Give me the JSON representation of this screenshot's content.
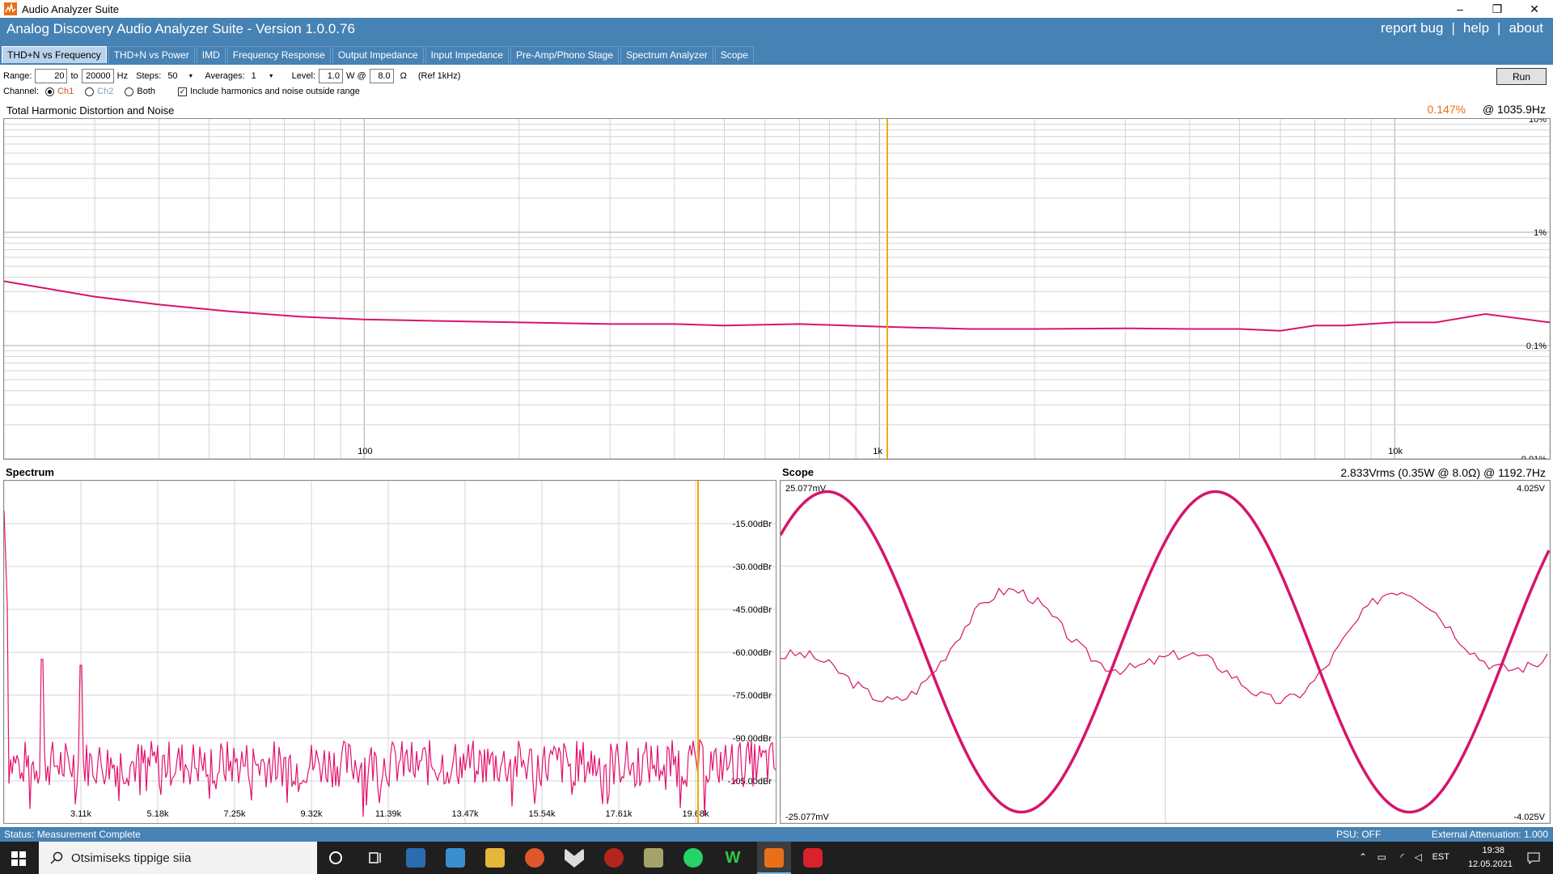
{
  "window": {
    "title": "Audio Analyzer Suite",
    "controls": {
      "minimize": "–",
      "restore": "❐",
      "close": "✕"
    }
  },
  "header": {
    "title": "Analog Discovery Audio Analyzer Suite - Version   1.0.0.76",
    "links": [
      "report bug",
      "help",
      "about"
    ],
    "separator": "|"
  },
  "tabs": [
    {
      "label": "THD+N vs Frequency",
      "active": true
    },
    {
      "label": "THD+N vs Power",
      "active": false
    },
    {
      "label": "IMD",
      "active": false
    },
    {
      "label": "Frequency Response",
      "active": false
    },
    {
      "label": "Output Impedance",
      "active": false
    },
    {
      "label": "Input Impedance",
      "active": false
    },
    {
      "label": "Pre-Amp/Phono Stage",
      "active": false
    },
    {
      "label": "Spectrum Analyzer",
      "active": false
    },
    {
      "label": "Scope",
      "active": false
    }
  ],
  "controls": {
    "range_label": "Range:",
    "range_from": "20",
    "to_label": "to",
    "range_to": "20000",
    "hz_label": "Hz",
    "steps_label": "Steps:",
    "steps_value": "50",
    "averages_label": "Averages:",
    "averages_value": "1",
    "level_label": "Level:",
    "level_value": "1.0",
    "w_at_label": "W @",
    "ohms_value": "8.0",
    "ohm_symbol": "Ω",
    "ref_label": "(Ref 1kHz)",
    "channel_label": "Channel:",
    "channel_options": [
      "Ch1",
      "Ch2",
      "Both"
    ],
    "channel_selected": "Ch1",
    "include_label": "Include harmonics and noise outside range",
    "include_checked": true,
    "run_label": "Run"
  },
  "thd_panel": {
    "title": "Total Harmonic Distortion and Noise",
    "readout_value": "0.147%",
    "readout_freq": "@ 1035.9Hz",
    "x_ticks": [
      "100",
      "1k",
      "10k"
    ],
    "y_ticks": [
      "10%",
      "1%",
      "0.1%",
      "0.01%"
    ],
    "cursor_freq_hz": 1035.9,
    "line_color": "#d6156c",
    "cursor_color": "#f2a900"
  },
  "spectrum_panel": {
    "title": "Spectrum",
    "y_ticks": [
      "-15.00dBr",
      "-30.00dBr",
      "-45.00dBr",
      "-60.00dBr",
      "-75.00dBr",
      "-90.00dBr",
      "-105.00dBr"
    ],
    "x_ticks": [
      "3.11k",
      "5.18k",
      "7.25k",
      "9.32k",
      "11.39k",
      "13.47k",
      "15.54k",
      "17.61k",
      "19.68k"
    ]
  },
  "scope_panel": {
    "title": "Scope",
    "readout": "2.833Vrms (0.35W @ 8.0Ω) @ 1192.7Hz",
    "left_top": "25.077mV",
    "left_bottom": "-25.077mV",
    "right_top": "4.025V",
    "right_bottom": "-4.025V"
  },
  "status": {
    "text": "Status: Measurement Complete",
    "psu": "PSU: OFF",
    "attenuation": "External Attenuation: 1.000"
  },
  "taskbar": {
    "search_placeholder": "Otsimiseks tippige siia",
    "lang": "EST",
    "time": "19:38",
    "date": "12.05.2021"
  },
  "chart_data": [
    {
      "type": "line",
      "title": "Total Harmonic Distortion and Noise",
      "x_scale": "log",
      "y_scale": "log",
      "xlim": [
        20,
        20000
      ],
      "ylim": [
        0.01,
        10
      ],
      "x_ticks": [
        "100",
        "1k",
        "10k"
      ],
      "y_ticks": [
        "10%",
        "1%",
        "0.1%",
        "0.01%"
      ],
      "series": [
        {
          "x": [
            20,
            30,
            40,
            55,
            75,
            100,
            140,
            200,
            300,
            400,
            500,
            700,
            1000,
            1500,
            2000,
            3000,
            4000,
            5000,
            6000,
            7000,
            8000,
            10000,
            12000,
            15000,
            20000
          ],
          "y": [
            0.37,
            0.27,
            0.23,
            0.2,
            0.18,
            0.17,
            0.165,
            0.16,
            0.155,
            0.155,
            0.15,
            0.155,
            0.147,
            0.14,
            0.14,
            0.142,
            0.14,
            0.14,
            0.135,
            0.15,
            0.15,
            0.16,
            0.16,
            0.19,
            0.16
          ]
        }
      ]
    },
    {
      "type": "line",
      "title": "Spectrum",
      "y_ticks": [
        "-15.00dBr",
        "-30.00dBr",
        "-45.00dBr",
        "-60.00dBr",
        "-75.00dBr",
        "-90.00dBr",
        "-105.00dBr"
      ],
      "x_ticks": [
        "3.11k",
        "5.18k",
        "7.25k",
        "9.32k",
        "11.39k",
        "13.47k",
        "15.54k",
        "17.61k",
        "19.68k"
      ],
      "ylim": [
        -115,
        0
      ],
      "peaks_dbr": [
        {
          "x_hz": 1040,
          "y": -60
        },
        {
          "x_hz": 2080,
          "y": -62
        }
      ],
      "noise_floor_dbr": -95
    },
    {
      "type": "line",
      "title": "Scope",
      "series": [
        {
          "name": "output",
          "waveform": "sine",
          "amplitude_v": 4.0,
          "cycles_visible": 2,
          "ylim": [
            -4.025,
            4.025
          ]
        },
        {
          "name": "residual",
          "waveform": "distortion residual",
          "ylim": [
            -0.025077,
            0.025077
          ]
        }
      ]
    }
  ]
}
